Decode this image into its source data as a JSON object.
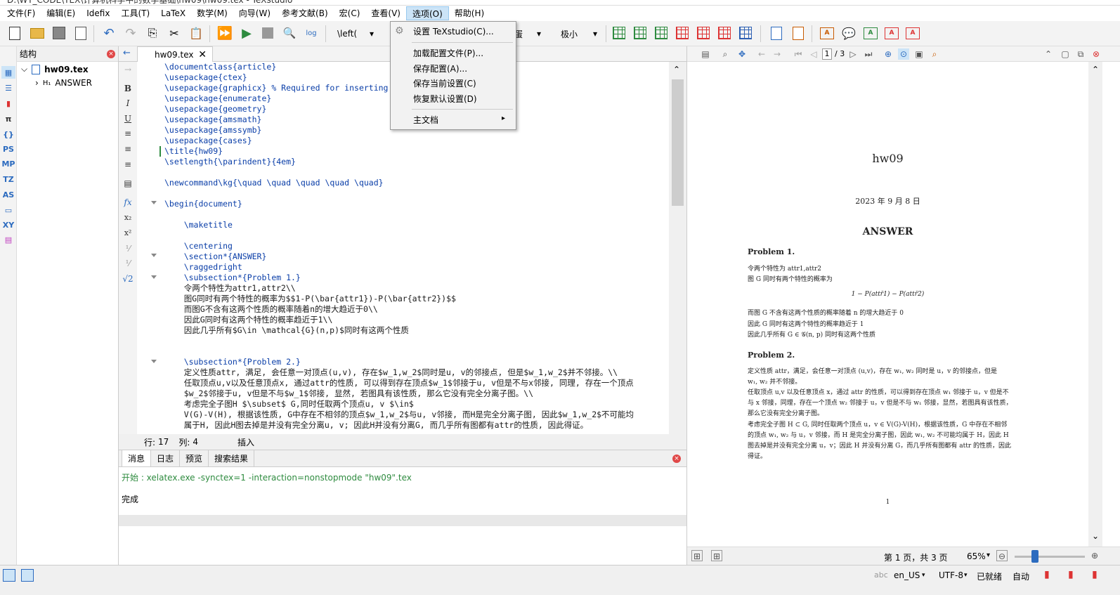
{
  "window": {
    "title": "D:\\WT_CODE\\TEX\\计算机科学中的数学基础\\hw09\\hw09.tex - TeXstudio"
  },
  "menubar": [
    "文件(F)",
    "编辑(E)",
    "Idefix",
    "工具(T)",
    "LaTeX",
    "数学(M)",
    "向导(W)",
    "参考文献(B)",
    "宏(C)",
    "查看(V)",
    "选项(O)",
    "帮助(H)"
  ],
  "toolbar": {
    "left_combo": "\\left(",
    "size_combo": "极小",
    "partial_combo": "蛋",
    "log_label": "log"
  },
  "options_menu": {
    "items": [
      "设置 TeXstudio(C)...",
      "加载配置文件(P)...",
      "保存配置(A)...",
      "保存当前设置(C)",
      "恢复默认设置(D)",
      "主文档"
    ]
  },
  "left_icons": [
    "PS",
    "MP",
    "TZ",
    "AS",
    "XY"
  ],
  "structure": {
    "title": "结构",
    "root": "hw09.tex",
    "child_prefix": "H₁",
    "child": "ANSWER"
  },
  "editor": {
    "tab": "hw09.tex",
    "lines": [
      "\\documentclass{article}",
      "\\usepackage{ctex}",
      "\\usepackage{graphicx} % Required for inserting",
      "\\usepackage{enumerate}",
      "\\usepackage{geometry}",
      "\\usepackage{amsmath}",
      "\\usepackage{amssymb}",
      "\\usepackage{cases}",
      "\\title{hw09}",
      "\\setlength{\\parindent}{4em}",
      "",
      "\\newcommand\\kg{\\quad \\quad \\quad \\quad \\quad}",
      "",
      "\\begin{document}",
      "",
      "    \\maketitle",
      "",
      "    \\centering",
      "    \\section*{ANSWER}",
      "    \\raggedright",
      "    \\subsection*{Problem 1.}",
      "    令两个特性为attr1,attr2\\\\",
      "    图G同时有两个特性的概率为$$1-P(\\bar{attr1})-P(\\bar{attr2})$$",
      "    而图G不含有这两个性质的概率随着n的增大趋近于0\\\\",
      "    因此G同时有这两个特性的概率趋近于1\\\\",
      "    因此几乎所有$G\\in \\mathcal{G}(n,p)$同时有这两个性质",
      "",
      "",
      "    \\subsection*{Problem 2.}",
      "    定义性质attr, 满足, 会任意一对顶点(u,v), 存在$w_1,w_2$同时是u, v的邻接点, 但是$w_1,w_2$并不邻接。\\\\",
      "    任取顶点u,v以及任意顶点x, 通过attr的性质, 可以得到存在顶点$w_1$邻接于u, v但是不与x邻接, 同理, 存在一个顶点",
      "    $w_2$邻接于u, v但是不与$w_1$邻接, 显然, 若图具有该性质, 那么它没有完全分离子图。\\\\",
      "    考虑完全子图H $\\subset$ G,同时任取两个顶点u, v $\\in$",
      "    V(G)-V(H), 根据该性质, G中存在不相邻的顶点$w_1,w_2$与u, v邻接, 而H是完全分离子图, 因此$w_1,w_2$不可能均",
      "    属于H, 因此H图去掉是并没有完全分离u, v; 因此H并没有分离G, 而几乎所有图都有attr的性质, 因此得证。"
    ]
  },
  "status": {
    "row_label": "行:",
    "row": "17",
    "col_label": "列:",
    "col": "4",
    "mode": "插入"
  },
  "messages": {
    "tabs": [
      "消息",
      "日志",
      "预览",
      "搜索结果"
    ],
    "line1": "开始 : xelatex.exe -synctex=1 -interaction=nonstopmode \"hw09\".tex",
    "line2": "完成"
  },
  "pdf": {
    "page_current": "1",
    "page_total": "/ 3",
    "title": "hw09",
    "date": "2023 年 9 月 8 日",
    "section": "ANSWER",
    "p1_head": "Problem 1.",
    "p1_l1": "令两个特性为 attr1,attr2",
    "p1_l2": "图 G 同时有两个特性的概率为",
    "p1_eq": "1 − P(attr̄1) − P(attr̄2)",
    "p1_l3": "而图 G 不含有这两个性质的概率随着 n 的增大趋近于 0",
    "p1_l4": "因此 G 同时有这两个特性的概率趋近于 1",
    "p1_l5": "因此几乎所有 G ∈ 𝒢(n, p) 同时有这两个性质",
    "p2_head": "Problem 2.",
    "p2_l1": "定义性质 attr，满足，会任意一对顶点 (u,v)，存在 w₁, w₂ 同时是 u，v 的邻接点，但是",
    "p2_l2": "w₁, w₂ 并不邻接。",
    "p2_l3": "任取顶点 u,v 以及任意顶点 x，通过 attr 的性质，可以得到存在顶点 w₁ 邻接于 u，v 但是不",
    "p2_l4": "与 x 邻接，同理，存在一个顶点 w₂ 邻接于 u，v 但是不与 w₁ 邻接，显然，若图具有该性质，",
    "p2_l5": "那么它没有完全分离子图。",
    "p2_l6": "考虑完全子图 H ⊂ G, 同时任取两个顶点 u，v ∈ V(G)-V(H)，根据该性质，G 中存在不相邻",
    "p2_l7": "的顶点 w₁, w₂ 与 u，v 邻接，而 H 是完全分离子图，因此 w₁, w₂ 不可能均属于 H，因此 H",
    "p2_l8": "图去掉是并没有完全分离 u，v；因此 H 并没有分离 G，而几乎所有图都有 attr 的性质，因此",
    "p2_l9": "得证。",
    "page_num": "1",
    "bottom_pages": "第 1 页，共 3 页",
    "zoom": "65%"
  },
  "bottombar": {
    "lang": "en_US",
    "encoding": "UTF-8",
    "ready": "已就绪",
    "auto": "自动"
  }
}
